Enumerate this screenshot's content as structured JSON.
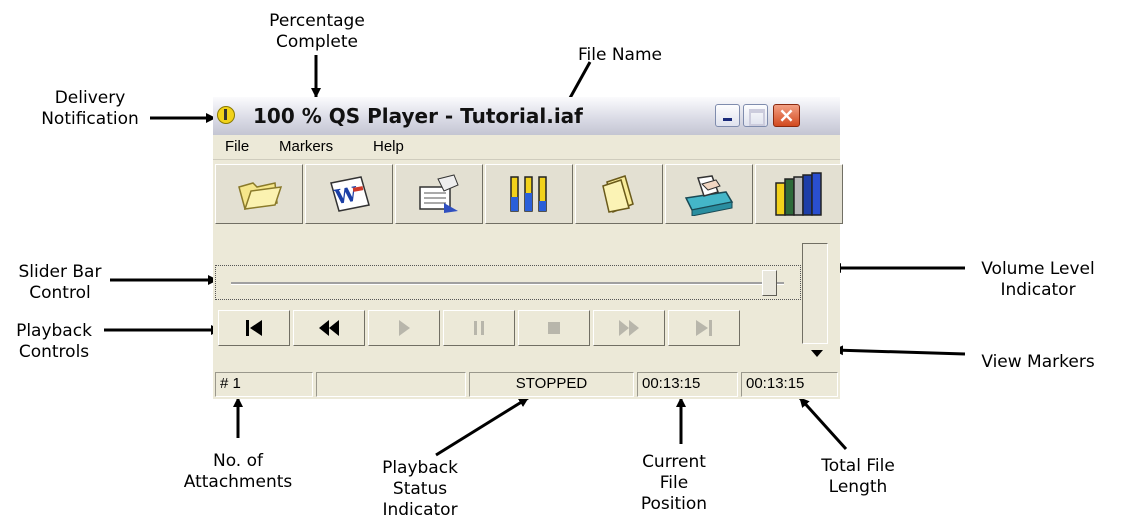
{
  "window": {
    "title": "100 % QS Player - Tutorial.iaf",
    "menu": [
      "File",
      "Markers",
      "Help"
    ],
    "toolbar_icons": [
      "open-folder-icon",
      "word-document-icon",
      "notepad-edit-icon",
      "level-bars-icon",
      "folder-icon",
      "hand-tray-icon",
      "books-icon"
    ],
    "playback_buttons": [
      {
        "name": "skip-to-start",
        "enabled": true
      },
      {
        "name": "rewind",
        "enabled": true
      },
      {
        "name": "play",
        "enabled": false
      },
      {
        "name": "pause",
        "enabled": false
      },
      {
        "name": "stop",
        "enabled": false
      },
      {
        "name": "fast-forward",
        "enabled": false
      },
      {
        "name": "skip-to-end",
        "enabled": false
      }
    ],
    "slider_position": 0.97,
    "status": {
      "attachments": "# 1",
      "empty": "",
      "playback_status": "STOPPED",
      "current_position": "00:13:15",
      "total_length": "00:13:15"
    }
  },
  "annotations": {
    "percentage_complete": [
      "Percentage",
      "Complete"
    ],
    "file_name": [
      "File Name"
    ],
    "delivery_notification": [
      "Delivery",
      "Notification"
    ],
    "slider_bar_control": [
      "Slider Bar",
      "Control"
    ],
    "playback_controls": [
      "Playback",
      "Controls"
    ],
    "volume_level_indicator": [
      "Volume Level",
      "Indicator"
    ],
    "view_markers": [
      "View Markers"
    ],
    "no_of_attachments": [
      "No. of",
      "Attachments"
    ],
    "playback_status_indicator": [
      "Playback",
      "Status",
      "Indicator"
    ],
    "current_file_position": [
      "Current",
      "File",
      "Position"
    ],
    "total_file_length": [
      "Total File",
      "Length"
    ]
  },
  "colors": {
    "window_bg": "#ece9d8",
    "title_bar": "#d8d9e4",
    "close_button": "#d24a1f"
  }
}
